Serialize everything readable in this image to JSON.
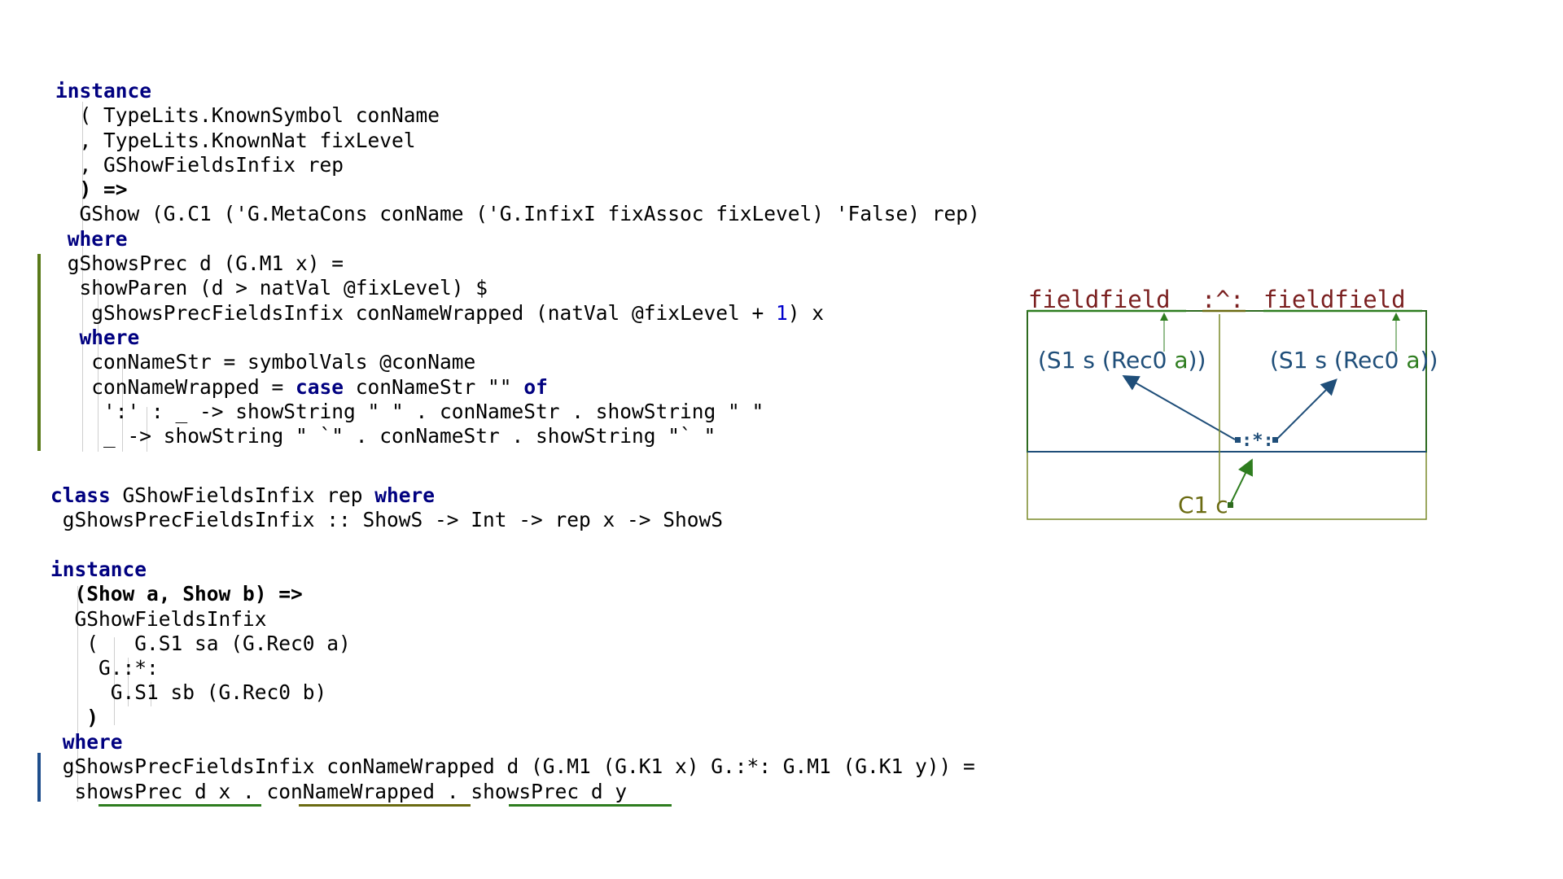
{
  "block1": {
    "l1": "instance",
    "l2": "( TypeLits.KnownSymbol conName",
    "l3": ", TypeLits.KnownNat fixLevel",
    "l4": ", GShowFieldsInfix rep",
    "l5": ") =>",
    "l6": "GShow (G.C1 ('G.MetaCons conName ('G.InfixI fixAssoc fixLevel) 'False) rep)",
    "l7": "where",
    "l8": "gShowsPrec d (G.M1 x) =",
    "l9": "showParen (d > natVal @fixLevel) $",
    "l10a": "gShowsPrecFieldsInfix conNameWrapped (natVal @fixLevel + ",
    "l10n": "1",
    "l10b": ") x",
    "l11": "where",
    "l12": "conNameStr = symbolVals @conName",
    "l13a": "conNameWrapped = ",
    "l13k": "case",
    "l13b": " conNameStr \"\" ",
    "l13k2": "of",
    "l14": "':' : _ -> showString \" \" . conNameStr . showString \" \"",
    "l15": "_ -> showString \" `\" . conNameStr . showString \"` \""
  },
  "block2": {
    "l1k": "class",
    "l1a": " GShowFieldsInfix rep ",
    "l1k2": "where",
    "l2": "gShowsPrecFieldsInfix :: ShowS -> Int -> rep x -> ShowS"
  },
  "block3": {
    "l1": "instance",
    "l2": "(Show a, Show b) =>",
    "l3": "GShowFieldsInfix",
    "l4": "(   G.S1 sa (G.Rec0 a)",
    "l5": "G.:*:",
    "l6": "G.S1 sb (G.Rec0 b)",
    "l7": ")",
    "l8": "where",
    "l9": "gShowsPrecFieldsInfix conNameWrapped d (G.M1 (G.K1 x) G.:*: G.M1 (G.K1 y)) =",
    "l10a": "showsPrec d x",
    "l10s1": " . ",
    "l10b": "conNameWrapped",
    "l10s2": " . ",
    "l10c": "showsPrec d y"
  },
  "diagram": {
    "field_left": "fieldfield",
    "op": ":^:",
    "field_right": "fieldfield",
    "s1_left_a": "(S1 s (Rec0 ",
    "s1_left_b": "a",
    "s1_left_c": "))",
    "s1_right_a": "(S1 s (Rec0 ",
    "s1_right_b": "a",
    "s1_right_c": "))",
    "product": ":*:",
    "c1": "C1 c",
    "colors": {
      "red": "#7a1f1f",
      "blue": "#1f4e79",
      "green": "#2e7d1f",
      "olive": "#6b6b12",
      "bar_green": "#5a7a1a",
      "bar_blue": "#1f4e8c"
    }
  }
}
